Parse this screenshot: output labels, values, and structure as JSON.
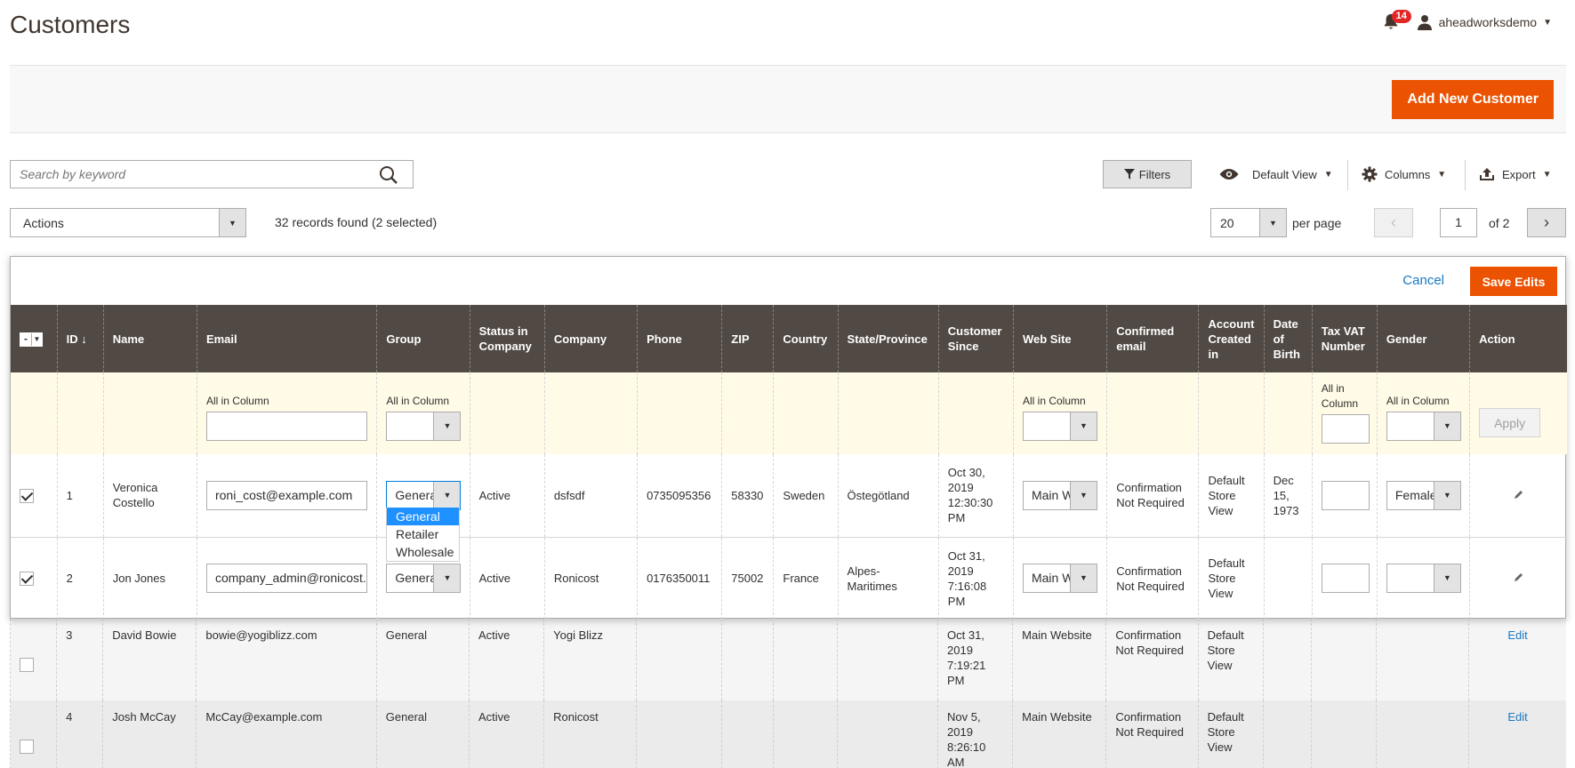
{
  "page": {
    "title": "Customers"
  },
  "header": {
    "notifications_count": "14",
    "username": "aheadworksdemo"
  },
  "action_bar": {
    "add_button": "Add New Customer"
  },
  "toolbar": {
    "search_placeholder": "Search by keyword",
    "filters_label": "Filters",
    "view_label": "Default View",
    "columns_label": "Columns",
    "export_label": "Export",
    "actions_label": "Actions",
    "records_text": "32 records found (2 selected)",
    "per_page_value": "20",
    "per_page_label": "per page",
    "page_current": "1",
    "page_total": "of 2"
  },
  "inline_edit": {
    "cancel_label": "Cancel",
    "save_label": "Save Edits",
    "apply_label": "Apply",
    "all_in_column": "All in Column"
  },
  "columns": [
    "ID",
    "Name",
    "Email",
    "Group",
    "Status in Company",
    "Company",
    "Phone",
    "ZIP",
    "Country",
    "State/Province",
    "Customer Since",
    "Web Site",
    "Confirmed email",
    "Account Created in",
    "Date of Birth",
    "Tax VAT Number",
    "Gender",
    "Action"
  ],
  "sort_indicator": "↓",
  "group_dropdown": {
    "options": [
      "General",
      "Retailer",
      "Wholesale"
    ],
    "selected": "General"
  },
  "edit_rows": [
    {
      "id": "1",
      "name": "Veronica Costello",
      "email": "roni_cost@example.com",
      "group": "General",
      "status": "Active",
      "company": "dsfsdf",
      "phone": "0735095356",
      "zip": "58330",
      "country": "Sweden",
      "state": "Östegötland",
      "since": "Oct 30, 2019 12:30:30 PM",
      "website": "Main Website",
      "confirmed": "Confirmation Not Required",
      "created_in": "Default Store View",
      "dob": "Dec 15, 1973",
      "taxvat": "",
      "gender": "Female"
    },
    {
      "id": "2",
      "name": "Jon Jones",
      "email": "company_admin@ronicost.com",
      "group": "General",
      "status": "Active",
      "company": "Ronicost",
      "phone": "0176350011",
      "zip": "75002",
      "country": "France",
      "state": "Alpes-Maritimes",
      "since": "Oct 31, 2019 7:16:08 PM",
      "website": "Main Website",
      "confirmed": "Confirmation Not Required",
      "created_in": "Default Store View",
      "dob": "",
      "taxvat": "",
      "gender": ""
    }
  ],
  "rows": [
    {
      "id": "3",
      "name": "David Bowie",
      "email": "bowie@yogiblizz.com",
      "group": "General",
      "status": "Active",
      "company": "Yogi Blizz",
      "phone": "",
      "zip": "",
      "country": "",
      "state": "",
      "since": "Oct 31, 2019 7:19:21 PM",
      "website": "Main Website",
      "confirmed": "Confirmation Not Required",
      "created_in": "Default Store View",
      "dob": "",
      "taxvat": "",
      "gender": "",
      "action": "Edit"
    },
    {
      "id": "4",
      "name": "Josh McCay",
      "email": "McCay@example.com",
      "group": "General",
      "status": "Active",
      "company": "Ronicost",
      "phone": "",
      "zip": "",
      "country": "",
      "state": "",
      "since": "Nov 5, 2019 8:26:10 AM",
      "website": "Main Website",
      "confirmed": "Confirmation Not Required",
      "created_in": "Default Store View",
      "dob": "",
      "taxvat": "",
      "gender": "",
      "action": "Edit"
    }
  ],
  "colors": {
    "accent": "#eb5202",
    "header_bg": "#514943",
    "link": "#1979c3",
    "filter_row_bg": "#fffbe6"
  }
}
